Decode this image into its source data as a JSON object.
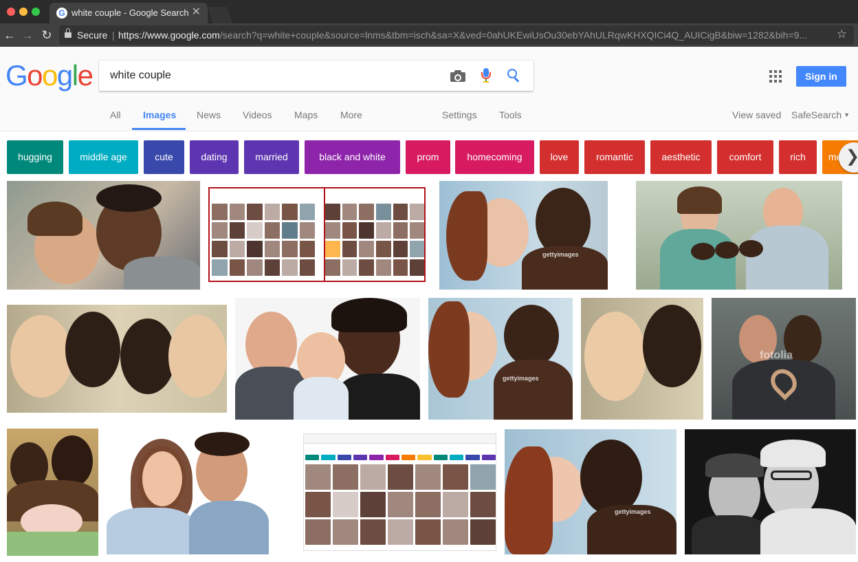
{
  "browser": {
    "tab_title": "white couple - Google Search",
    "tab_close": "✕",
    "secure_label": "Secure",
    "url_host": "https://www.google.com",
    "url_rest": "/search?q=white+couple&source=lnms&tbm=isch&sa=X&ved=0ahUKEwiUsOu30ebYAhULRqwKHXQICi4Q_AUICigB&biw=1282&bih=9...",
    "favicon_glyph": "G"
  },
  "logo": {
    "letters": [
      {
        "char": "G",
        "color": "#4285f4"
      },
      {
        "char": "o",
        "color": "#ea4335"
      },
      {
        "char": "o",
        "color": "#fbbc05"
      },
      {
        "char": "g",
        "color": "#4285f4"
      },
      {
        "char": "l",
        "color": "#34a853"
      },
      {
        "char": "e",
        "color": "#ea4335"
      }
    ]
  },
  "search": {
    "query": "white couple"
  },
  "header": {
    "sign_in_label": "Sign in"
  },
  "nav": {
    "tabs": [
      "All",
      "Images",
      "News",
      "Videos",
      "Maps",
      "More"
    ],
    "settings": "Settings",
    "tools": "Tools",
    "view_saved": "View saved",
    "safesearch": "SafeSearch",
    "active_tab": "Images"
  },
  "chips": [
    {
      "label": "hugging",
      "color": "#00897b"
    },
    {
      "label": "middle age",
      "color": "#00acc1"
    },
    {
      "label": "cute",
      "color": "#3949ab"
    },
    {
      "label": "dating",
      "color": "#5e35b1"
    },
    {
      "label": "married",
      "color": "#5e35b1"
    },
    {
      "label": "black and white",
      "color": "#8e24aa"
    },
    {
      "label": "prom",
      "color": "#d81b60"
    },
    {
      "label": "homecoming",
      "color": "#d81b60"
    },
    {
      "label": "love",
      "color": "#d32f2f"
    },
    {
      "label": "romantic",
      "color": "#d32f2f"
    },
    {
      "label": "aesthetic",
      "color": "#d32f2f"
    },
    {
      "label": "comfort",
      "color": "#d32f2f"
    },
    {
      "label": "rich",
      "color": "#d32f2f"
    },
    {
      "label": "mexican",
      "color": "#f57c00"
    }
  ],
  "watermarks": {
    "gettyimages": "gettyimages",
    "fotolia": "fotolia"
  }
}
